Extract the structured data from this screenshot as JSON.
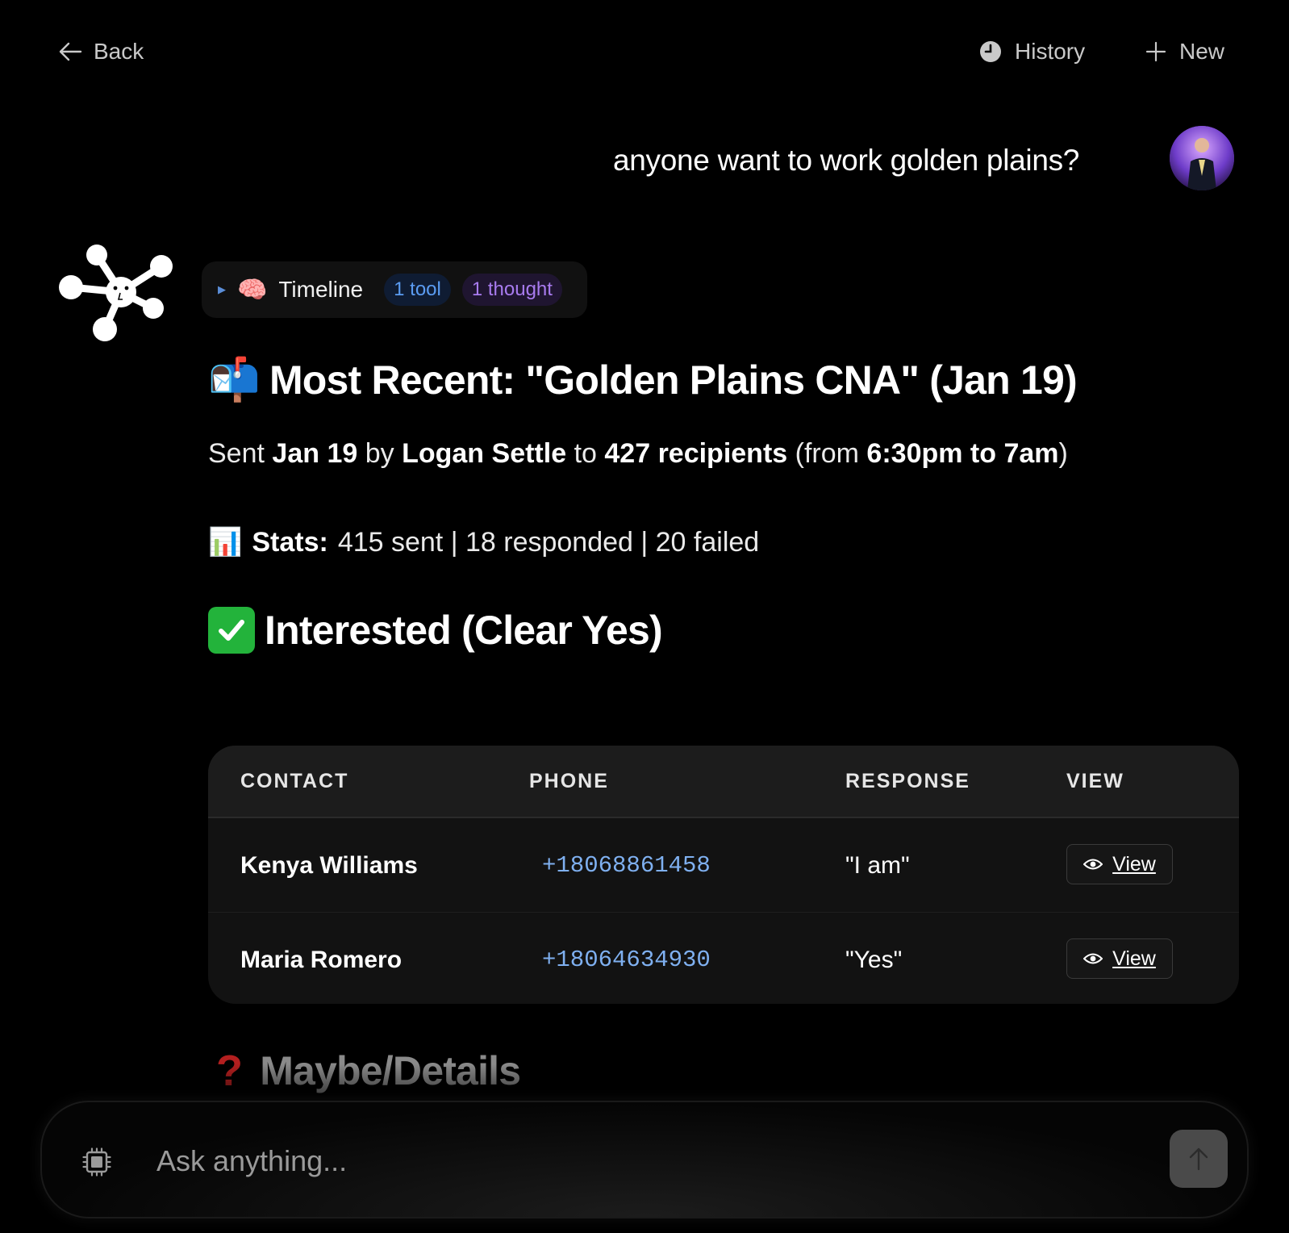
{
  "header": {
    "back_label": "Back",
    "history_label": "History",
    "new_label": "New"
  },
  "user_message": {
    "text": "anyone want to work golden plains?"
  },
  "timeline": {
    "label": "Timeline",
    "tool_badge": "1 tool",
    "thought_badge": "1 thought"
  },
  "response": {
    "heading_emoji": "📬",
    "heading": "Most Recent: \"Golden Plains CNA\" (Jan 19)",
    "sent": {
      "prefix": "Sent",
      "date": "Jan 19",
      "by": "by",
      "sender": "Logan Settle",
      "to": "to",
      "recipients": "427 recipients",
      "from_open": "(from",
      "time_range": "6:30pm to 7am",
      "from_close": ")"
    },
    "stats": {
      "emoji": "📊",
      "label": "Stats:",
      "text": "415 sent | 18 responded | 20 failed"
    },
    "interested_heading": "Interested (Clear Yes)",
    "table": {
      "headers": [
        "CONTACT",
        "PHONE",
        "RESPONSE",
        "VIEW"
      ],
      "rows": [
        {
          "name": "Kenya Williams",
          "phone": "+18068861458",
          "response": "\"I am\"",
          "view": "View"
        },
        {
          "name": "Maria Romero",
          "phone": "+18064634930",
          "response": "\"Yes\"",
          "view": "View"
        }
      ]
    },
    "maybe_heading": "Maybe/Details"
  },
  "composer": {
    "placeholder": "Ask anything..."
  },
  "colors": {
    "background": "#000000",
    "tool_badge": "#5b9cf2",
    "thought_badge": "#a87bef",
    "phone_link": "#7fb0f0",
    "check_green": "#23b33b"
  },
  "icons": {
    "back": "arrow-left-icon",
    "history": "clock-icon",
    "new": "plus-icon",
    "timeline_caret": "caret-right-icon",
    "timeline_brain": "brain-icon",
    "view": "eye-icon",
    "composer_left": "cpu-chip-icon",
    "send": "arrow-up-icon"
  }
}
